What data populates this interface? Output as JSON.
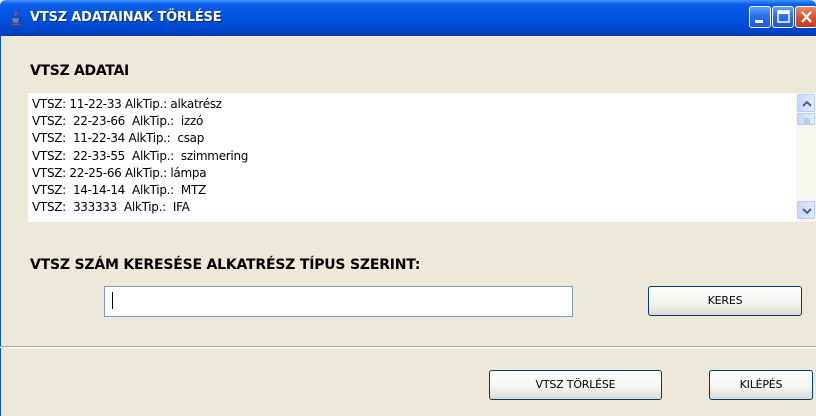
{
  "window": {
    "title": "VTSZ ADATAINAK TÖRLÉSE",
    "icons": [
      "app-icon",
      "minimize-icon",
      "maximize-icon",
      "close-icon"
    ]
  },
  "list_section": {
    "label": "VTSZ ADATAI",
    "items": [
      "VTSZ: 11-22-33 AlkTip.: alkatrész",
      "VTSZ:  22-23-66  AlkTip.:  izzó",
      "VTSZ:  11-22-34 AlkTip.:  csap",
      "VTSZ:  22-33-55  AlkTip.:  szimmering",
      "VTSZ: 22-25-66 AlkTip.: lámpa",
      "VTSZ:  14-14-14  AlkTip.:  MTZ",
      "VTSZ:  333333  AlkTip.:  IFA"
    ]
  },
  "search": {
    "label": "VTSZ SZÁM KERESÉSE ALKATRÉSZ TÍPUS SZERINT:",
    "value": "",
    "button_label": "KERES"
  },
  "actions": {
    "delete_label": "VTSZ TÖRLÉSE",
    "exit_label": "KILÉPÉS"
  },
  "colors": {
    "titlebar": "#0054e3",
    "background": "#ece9d8",
    "close_button": "#d8562f"
  }
}
